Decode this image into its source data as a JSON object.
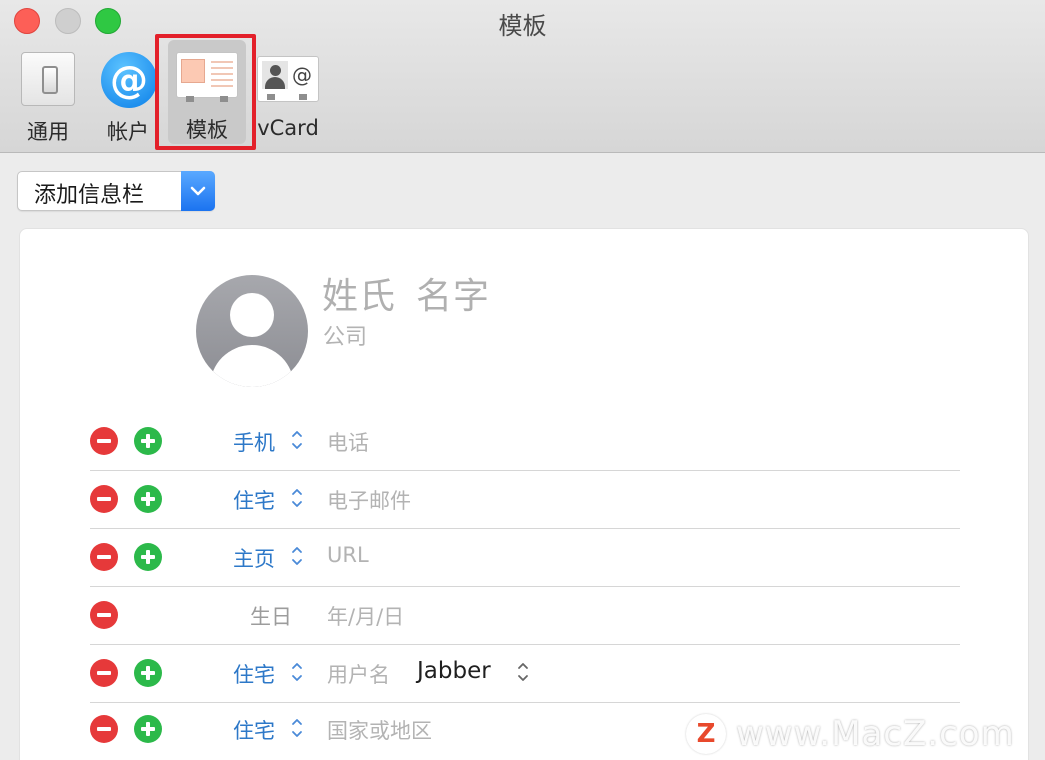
{
  "window": {
    "title": "模板"
  },
  "toolbar": {
    "items": [
      {
        "label": "通用"
      },
      {
        "label": "帐户"
      },
      {
        "label": "模板"
      },
      {
        "label": "vCard"
      }
    ],
    "selected": "模板",
    "vcard_icon_text": "@",
    "account_icon_text": "@"
  },
  "add_field": {
    "label": "添加信息栏"
  },
  "card": {
    "last_name": "姓氏",
    "first_name": "名字",
    "company": "公司"
  },
  "fields": [
    {
      "type": "手机",
      "placeholder": "电话"
    },
    {
      "type": "住宅",
      "placeholder": "电子邮件"
    },
    {
      "type": "主页",
      "placeholder": "URL"
    },
    {
      "type": "生日",
      "placeholder": "年/月/日"
    },
    {
      "type": "住宅",
      "placeholder": "用户名",
      "service": "Jabber"
    },
    {
      "type": "住宅",
      "placeholder": "国家或地区"
    }
  ],
  "watermark": {
    "logo": "Z",
    "text": "www.MacZ.com"
  },
  "colors": {
    "accent_label": "#2d78c8",
    "remove": "#e6393a",
    "add": "#2cb94a",
    "highlight": "#e3202a"
  }
}
